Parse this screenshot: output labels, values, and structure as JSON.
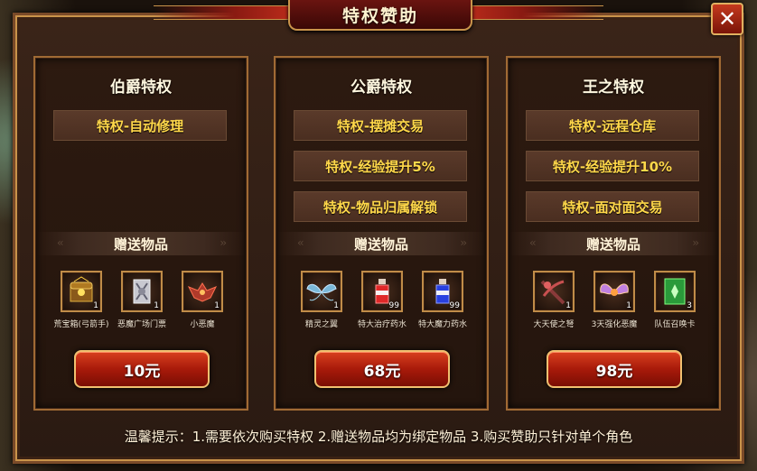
{
  "window": {
    "title": "特权赞助",
    "close_icon": "close-icon"
  },
  "panels": [
    {
      "title": "伯爵特权",
      "privileges": [
        "特权-自动修理"
      ],
      "gift_title": "赠送物品",
      "items": [
        {
          "name": "荒宝箱(弓箭手)",
          "count": "1",
          "icon": "treasure-chest-icon"
        },
        {
          "name": "恶魔广场门票",
          "count": "1",
          "icon": "ticket-scroll-icon"
        },
        {
          "name": "小恶魔",
          "count": "1",
          "icon": "imp-pet-icon"
        }
      ],
      "price": "10元"
    },
    {
      "title": "公爵特权",
      "privileges": [
        "特权-摆摊交易",
        "特权-经验提升5%",
        "特权-物品归属解锁"
      ],
      "gift_title": "赠送物品",
      "items": [
        {
          "name": "精灵之翼",
          "count": "1",
          "icon": "fairy-wings-icon"
        },
        {
          "name": "特大治疗药水",
          "count": "99",
          "icon": "red-potion-icon"
        },
        {
          "name": "特大魔力药水",
          "count": "99",
          "icon": "blue-potion-icon"
        }
      ],
      "price": "68元"
    },
    {
      "title": "王之特权",
      "privileges": [
        "特权-远程仓库",
        "特权-经验提升10%",
        "特权-面对面交易"
      ],
      "gift_title": "赠送物品",
      "items": [
        {
          "name": "大天使之弩",
          "count": "1",
          "icon": "crossbow-icon"
        },
        {
          "name": "3天强化恶魔",
          "count": "1",
          "icon": "winged-demon-icon"
        },
        {
          "name": "队伍召唤卡",
          "count": "3",
          "icon": "summon-card-icon"
        }
      ],
      "price": "98元"
    }
  ],
  "tip": "温馨提示：1.需要依次购买特权 2.赠送物品均为绑定物品 3.购买赞助只针对单个角色",
  "colors": {
    "privilege_text": "#ffd84a",
    "button_red": "#a81a0a",
    "gold_border": "#c9934a"
  }
}
